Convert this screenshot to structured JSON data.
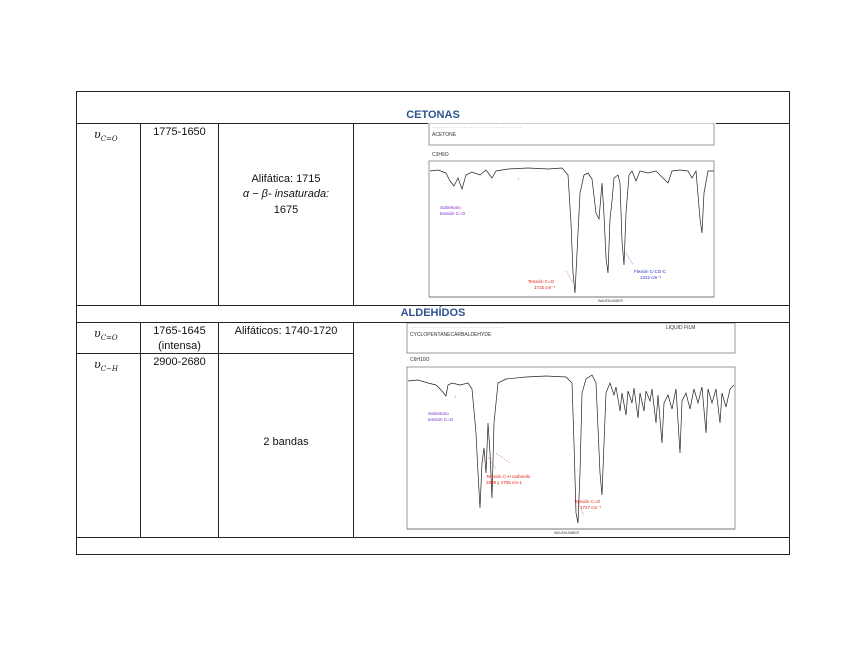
{
  "sections": {
    "ketones": {
      "title": "CETONAS",
      "row1": {
        "symbol": "υ",
        "symbol_sub": "C=O",
        "range": "1775-1650",
        "assign_line1": "Alifática: 1715",
        "assign_line2": "α − β- insaturada:",
        "assign_line3": "1675"
      },
      "spectrum": {
        "header_text": "ACETONE",
        "formula": "C3H6O",
        "annot_overtone_1": "Sobretono",
        "annot_overtone_2": "tensión C=O",
        "annot_stretch_1": "Tensión C=O",
        "annot_stretch_2": "1715 cm⁻¹",
        "annot_bend_1": "Flexión C-CO-C",
        "annot_bend_2": "1222 cm⁻¹",
        "xaxis_label": "WAVENUMBER"
      }
    },
    "aldehydes": {
      "title": "ALDEHÍDOS",
      "row1": {
        "symbol": "υ",
        "symbol_sub": "C=O",
        "range_line1": "1765-1645",
        "range_line2": "(intensa)",
        "assign": "Alifáticos: 1740-1720"
      },
      "row2": {
        "symbol": "υ",
        "symbol_sub": "C−H",
        "range": "2900-2680",
        "assign": "2 bandas"
      },
      "spectrum": {
        "header_text": "CYCLOPENTANECARBALDEHYDE",
        "formula": "C6H10O",
        "header_right": "LIQUID FILM",
        "annot_overtone_1": "Sobretono",
        "annot_overtone_2": "tensión C=O",
        "annot_ch_1": "Tensión C-H carbonilo",
        "annot_ch_2": "2809 y 2705 cm-1",
        "annot_co_1": "Tensión C=O",
        "annot_co_2": "1727 cm⁻¹",
        "xaxis_label": "WAVENUMBER"
      }
    }
  }
}
